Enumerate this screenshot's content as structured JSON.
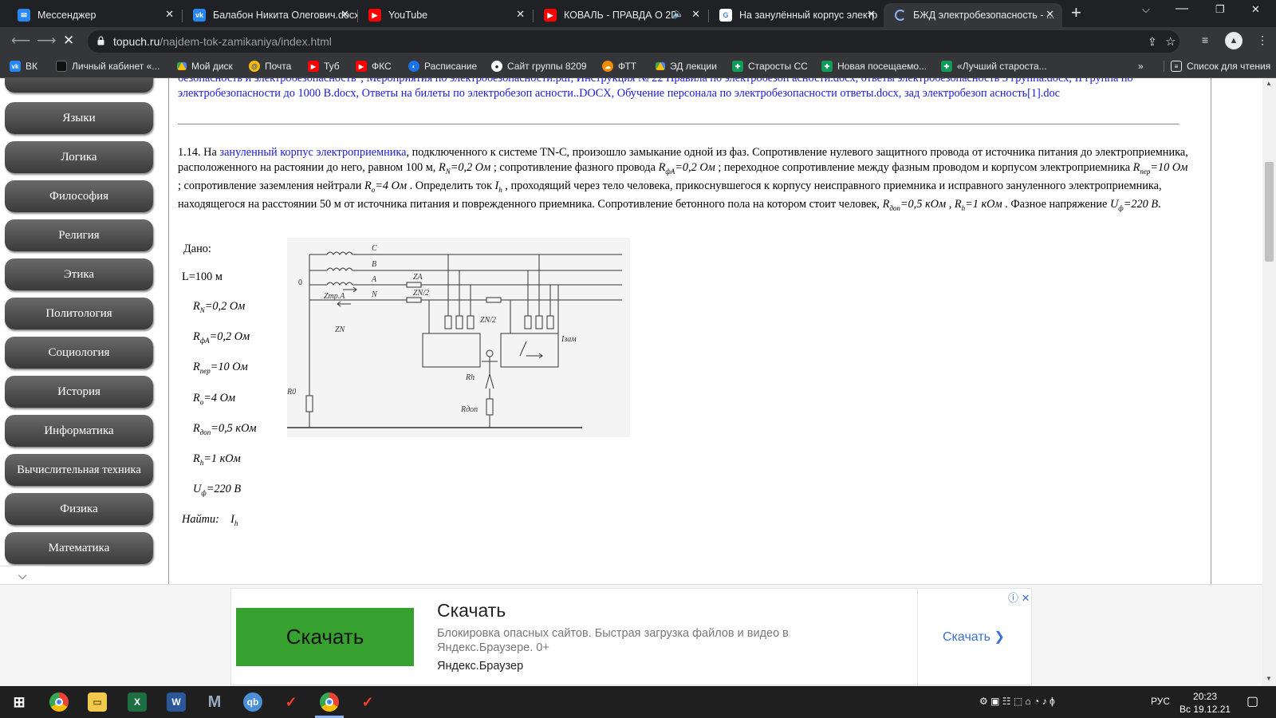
{
  "browser": {
    "tabs": [
      {
        "title": "Мессенджер",
        "favicon": "vk-messenger-icon",
        "color": "#2787f5"
      },
      {
        "title": "Балабон Никита Олегович.docx",
        "favicon": "vk-icon",
        "color": "#2787f5"
      },
      {
        "title": "YouTube",
        "favicon": "youtube-icon",
        "color": "#ff0000"
      },
      {
        "title": "КОВАЛЬ - ПРАВДА О 2D",
        "favicon": "youtube-icon",
        "color": "#ff0000"
      },
      {
        "title": "На занулённый корпус электр",
        "favicon": "google-icon",
        "color": "#ffffff"
      },
      {
        "title": "БЖД электробезопасность - ...",
        "favicon": "loading-icon",
        "color": "#8ab4f8"
      }
    ],
    "url_host": "topuch.ru",
    "url_path": "/najdem-tok-zamikaniya/index.html",
    "bookmarks": [
      {
        "label": "ВК",
        "color": "#2787f5",
        "icon": "vk-icon"
      },
      {
        "label": "Личный кабинет «...",
        "color": "#e8eaed",
        "icon": "black-square-icon"
      },
      {
        "label": "Мой диск",
        "color": "#fbbc04",
        "icon": "google-drive-icon"
      },
      {
        "label": "Почта",
        "color": "#fbbc04",
        "icon": "mail-icon"
      },
      {
        "label": "Туб",
        "color": "#ff0000",
        "icon": "youtube-icon"
      },
      {
        "label": "ФКС",
        "color": "#ff0000",
        "icon": "youtube-icon"
      },
      {
        "label": "Расписание",
        "color": "#1a73e8",
        "icon": "schedule-icon"
      },
      {
        "label": "Сайт группы 8209",
        "color": "#e8eaed",
        "icon": "github-icon"
      },
      {
        "label": "ФТТ",
        "color": "#f28b00",
        "icon": "cloud-icon"
      },
      {
        "label": "ЭД лекции",
        "color": "#fbbc04",
        "icon": "google-drive-icon"
      },
      {
        "label": "Старосты СС",
        "color": "#0f9d58",
        "icon": "sheets-icon"
      },
      {
        "label": "Новая посещаемо...",
        "color": "#0f9d58",
        "icon": "sheets-icon"
      },
      {
        "label": "«Лучший староста...",
        "color": "#0f9d58",
        "icon": "sheets-icon"
      }
    ],
    "bookmarks_more": "»",
    "reading_list": "Список для чтения"
  },
  "sidebar": {
    "items": [
      "Языки",
      "Логика",
      "Философия",
      "Религия",
      "Этика",
      "Политология",
      "Социология",
      "История",
      "Информатика",
      "Вычислительная техника",
      "Физика",
      "Математика"
    ],
    "arrow": "⌵"
  },
  "content": {
    "links_text": "безопасность и электробезопасность\", Мероприятия по электробезопасности.pdf, Инструкция № 22 Правила по электробезоп асности.docx, ответы электробезопасность 3 группа.docx, II группа по электробезопасности до 1000 В.docx, Ответы на билеты по электробезоп асности..DOCX, Обучение персонала по электробезопасности ответы.docx, зад электробезоп асность[1].doc",
    "problem": {
      "t1": "1.14. На ",
      "link": "зануленный корпус электроприемника",
      "t2": ", подключенного к системе TN-C, произошло замыкание одной из фаз. Сопротивление нулевого защитного провода от источника питания до электроприемника, расположенного на растоянии до него, равном 100 м, ",
      "f1": "R",
      "f1s": "N",
      "f1v": "=0,2 Ом",
      "t3": " ; сопротивление фазного провода ",
      "f2": "R",
      "f2s": "фА",
      "f2v": "=0,2 Ом",
      "t4": " ; переходное сопротивление между фазным проводом и корпусом электроприемника ",
      "f3": "R",
      "f3s": "пер",
      "f3v": "=10 Ом",
      "t5": " ; сопротивление заземления нейтрали ",
      "f4": "R",
      "f4s": "о",
      "f4v": "=4 Ом",
      "t6": " . Определить ток ",
      "f5": "I",
      "f5s": "h",
      "t7": " , проходящий через тело человека, прикоснувшегося к корпусу неисправного приемника и исправного зануленного электроприемника, находящегося на расстоянии 50 м от источника питания и поврежденного приемника. Сопротивление бетонного пола на котором стоит человек, ",
      "f6": "R",
      "f6s": "доп",
      "f6v": "=0,5 кОм",
      "t8": " , ",
      "f7": "R",
      "f7s": "h",
      "f7v": "=1 кОм",
      "t9": " . Фазное напряжение ",
      "f8": "U",
      "f8s": "ф",
      "f8v": "=220 В",
      "t10": "."
    },
    "given": {
      "title": "Дано:",
      "L": "L=100 м",
      "items": [
        {
          "s": "R",
          "sub": "N",
          "v": "=0,2 Ом"
        },
        {
          "s": "R",
          "sub": "фА",
          "v": "=0,2 Ом"
        },
        {
          "s": "R",
          "sub": "пер",
          "v": "=10 Ом"
        },
        {
          "s": "R",
          "sub": "о",
          "v": "=4 Ом"
        },
        {
          "s": "R",
          "sub": "доп",
          "v": "=0,5 кОм"
        },
        {
          "s": "R",
          "sub": "h",
          "v": "=1 кОм"
        },
        {
          "s": "U",
          "sub": "ф",
          "v": "=220 В"
        }
      ],
      "find_label": "Найти:",
      "find_s": "I",
      "find_sub": "h"
    },
    "circuit_labels": {
      "C": "C",
      "B": "B",
      "A": "A",
      "N": "N",
      "zero": "0",
      "ZA": "ZA",
      "Ztp": "Zтр.А",
      "ZN": "ZN",
      "ZN2a": "ZN/2",
      "ZN2b": "ZN/2",
      "R0": "R0",
      "Rh": "Rh",
      "Rdop": "Rдоп",
      "Izam": "Iзам"
    }
  },
  "ad": {
    "button_big": "Скачать",
    "title": "Скачать",
    "text": "Блокировка опасных сайтов. Быстрая загрузка файлов и видео в Яндекс.Браузере. 0+",
    "brand": "Яндекс.Браузер",
    "link": "Скачать",
    "info": "ⓘ ✕"
  },
  "taskbar": {
    "lang": "РУС",
    "time": "20:23",
    "date": "Вс 19.12.21"
  }
}
